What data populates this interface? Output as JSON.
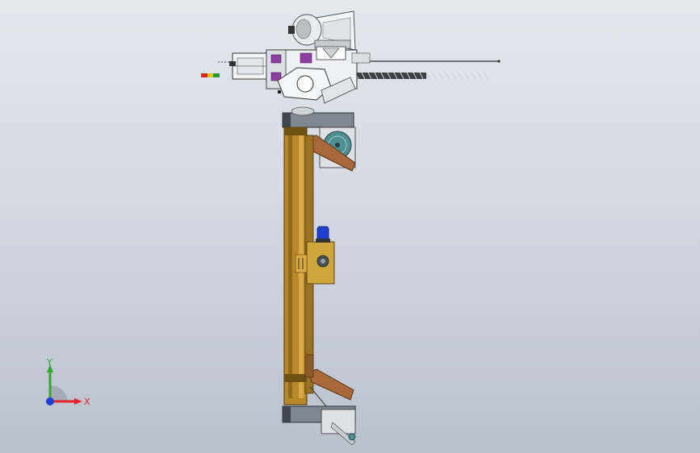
{
  "view": {
    "background_top": "#e4e8ef",
    "background_bottom": "#b9c1cc"
  },
  "triad": {
    "x_label": "X",
    "y_label": "Y",
    "x_color": "#e8242a",
    "y_color": "#2ea82e",
    "z_color": "#1d3fd6"
  },
  "colors": {
    "frame_wood": "#b8892a",
    "frame_dark": "#6e4f14",
    "steel_gray": "#7f8790",
    "steel_dark": "#3f464d",
    "bracket_rust": "#a8683a",
    "panel_tan": "#cfa63c",
    "beacon_blue": "#1f3fd0",
    "fitting_purple": "#8a3fa0",
    "wheel_teal": "#4f8f93",
    "led_red": "#d62a1f",
    "led_yellow": "#e2c21b",
    "led_green": "#2a9a2a"
  },
  "components": [
    "horn-assembly",
    "drill-head",
    "drill-bit",
    "auger-spiral",
    "top-gearbox",
    "upper-wheel",
    "main-frame",
    "control-box",
    "blue-beacon",
    "lower-bracket",
    "lower-wheel",
    "status-light-bar"
  ]
}
